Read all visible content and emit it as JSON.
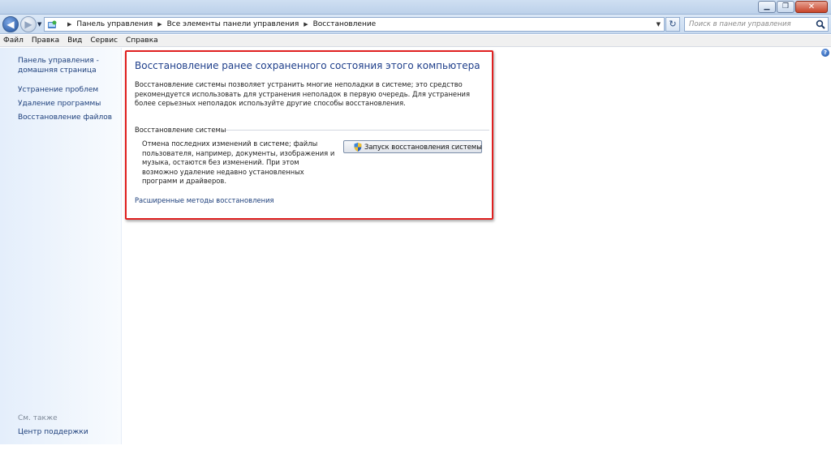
{
  "window": {
    "minimize_glyph": "▁",
    "maximize_glyph": "❐",
    "close_glyph": "✕"
  },
  "address": {
    "breadcrumbs": [
      "Панель управления",
      "Все элементы панели управления",
      "Восстановление"
    ],
    "back_glyph": "◀",
    "forward_glyph": "▶",
    "refresh_glyph": "↻"
  },
  "search": {
    "placeholder": "Поиск в панели управления"
  },
  "menu": {
    "items": [
      "Файл",
      "Правка",
      "Вид",
      "Сервис",
      "Справка"
    ]
  },
  "sidebar": {
    "home_line1": "Панель управления -",
    "home_line2": "домашняя страница",
    "items": [
      {
        "label": "Устранение проблем"
      },
      {
        "label": "Удаление программы"
      },
      {
        "label": "Восстановление файлов"
      }
    ],
    "see_also_label": "См. также",
    "support_center": "Центр поддержки"
  },
  "main": {
    "title": "Восстановление ранее сохраненного состояния этого компьютера",
    "description": "Восстановление системы позволяет устранить многие неполадки в системе; это средство рекомендуется использовать для устранения неполадок в первую очередь. Для устранения более серьезных неполадок используйте другие способы восстановления.",
    "section_label": "Восстановление системы",
    "section_text": "Отмена последних изменений в системе; файлы пользователя, например, документы, изображения и музыка, остаются без изменений. При этом возможно удаление недавно установленных программ и драйверов.",
    "restore_button_label": "Запуск восстановления системы",
    "advanced_link": "Расширенные методы восстановления"
  },
  "help": {
    "glyph": "?"
  },
  "colors": {
    "highlight_border": "#e02020",
    "link": "#1d3f7b",
    "title": "#1f3f8b"
  }
}
